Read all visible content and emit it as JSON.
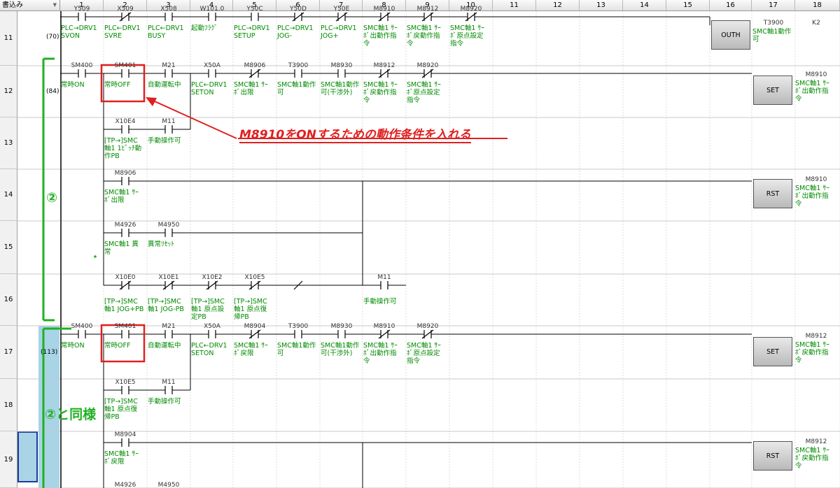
{
  "toolbar": {
    "mode": "書込み"
  },
  "columns": [
    "1",
    "2",
    "3",
    "4",
    "5",
    "6",
    "7",
    "8",
    "9",
    "10",
    "11",
    "12",
    "13",
    "14",
    "15",
    "16",
    "17",
    "18"
  ],
  "rows": [
    "11",
    "12",
    "13",
    "14",
    "15",
    "16",
    "17",
    "18",
    "19"
  ],
  "steps": {
    "s70": "(70)",
    "s84": "(84)",
    "s113": "(113)"
  },
  "rung70": {
    "devices": [
      "Y509",
      "X509",
      "X508",
      "W101.0",
      "Y50C",
      "Y50D",
      "Y50E",
      "M8910",
      "M8912",
      "M8920"
    ],
    "comments": [
      "PLC→DRV1\nSVON",
      "PLC←DRV1\nSVRE",
      "PLC←DRV1\nBUSY",
      "起動ﾌﾗｸﾞ",
      "PLC→DRV1\nSETUP",
      "PLC→DRV1\nJOG-",
      "PLC→DRV1\nJOG+",
      "SMC軸1 ｻｰ\nﾎﾞ出動作指\n令",
      "SMC軸1 ｻｰ\nﾎﾞ戻動作指\n令",
      "SMC軸1 ｻｰ\nﾎﾞ原点設定\n指令"
    ],
    "coil": "OUTH",
    "out_device": "T3900",
    "out_comment": "SMC軸1動作\n可",
    "constant": "K2"
  },
  "rung84": {
    "devices": [
      "SM400",
      "SM401",
      "M21",
      "X50A",
      "M8906",
      "T3900",
      "M8930",
      "M8912",
      "M8920"
    ],
    "comments": [
      "常時ON",
      "常時OFF",
      "自動運転中",
      "PLC←DRV1\nSETON",
      "SMC軸1 ｻｰ\nﾎﾞ出限",
      "SMC軸1動作\n可",
      "SMC軸1動作\n可(干渉外)",
      "SMC軸1 ｻｰ\nﾎﾞ戻動作指\n令",
      "SMC軸1 ｻｰ\nﾎﾞ原点設定\n指令"
    ],
    "coil": "SET",
    "out_device": "M8910",
    "out_comment": "SMC軸1 ｻｰ\nﾎﾞ出動作指\n令",
    "branch1_devices": [
      "X10E4",
      "M11"
    ],
    "branch1_comments": [
      "[TP→]SMC\n軸1 1ﾋﾟｯﾁ動\n作PB",
      "手動操作可"
    ],
    "rst_device": "M8906",
    "rst_comment": "SMC軸1 ｻｰ\nﾎﾞ出限",
    "rst_coil": "RST",
    "rst_out_device": "M8910",
    "rst_out_comment": "SMC軸1 ｻｰ\nﾎﾞ出動作指\n令",
    "branch2_devices": [
      "M4926",
      "M4950"
    ],
    "branch2_comments": [
      "SMC軸1 異\n常",
      "異常ﾘｾｯﾄ"
    ],
    "branch3_devices": [
      "X10E0",
      "X10E1",
      "X10E2",
      "X10E5",
      "M11"
    ],
    "branch3_comments": [
      "[TP→]SMC\n軸1 JOG+PB",
      "[TP→]SMC\n軸1 JOG-PB",
      "[TP→]SMC\n軸1 原点設\n定PB",
      "[TP→]SMC\n軸1 原点復\n帰PB",
      "手動操作可"
    ]
  },
  "rung113": {
    "devices": [
      "SM400",
      "SM401",
      "M21",
      "X50A",
      "M8904",
      "T3900",
      "M8930",
      "M8910",
      "M8920"
    ],
    "comments": [
      "常時ON",
      "常時OFF",
      "自動運転中",
      "PLC←DRV1\nSETON",
      "SMC軸1 ｻｰ\nﾎﾞ戻限",
      "SMC軸1動作\n可",
      "SMC軸1動作\n可(干渉外)",
      "SMC軸1 ｻｰ\nﾎﾞ出動作指\n令",
      "SMC軸1 ｻｰ\nﾎﾞ原点設定\n指令"
    ],
    "coil": "SET",
    "out_device": "M8912",
    "out_comment": "SMC軸1 ｻｰ\nﾎﾞ戻動作指\n令",
    "branch1_devices": [
      "X10E5",
      "M11"
    ],
    "branch1_comments": [
      "[TP→]SMC\n軸1 原点復\n帰PB",
      "手動操作可"
    ],
    "rst_device": "M8904",
    "rst_comment": "SMC軸1 ｻｰ\nﾎﾞ戻限",
    "rst_coil": "RST",
    "rst_out_device": "M8912",
    "rst_out_comment": "SMC軸1 ｻｰ\nﾎﾞ戻動作指\n令",
    "branch2_devices": [
      "M4926",
      "M4950"
    ]
  },
  "annotations": {
    "red_note": "M8910をONするための動作条件を入れる",
    "green_label": "②",
    "green_label2": "②と同様"
  },
  "colors": {
    "comment": "#008a00",
    "annotation_red": "#e02020",
    "annotation_green": "#22b022",
    "selection": "#a8d4e6"
  }
}
